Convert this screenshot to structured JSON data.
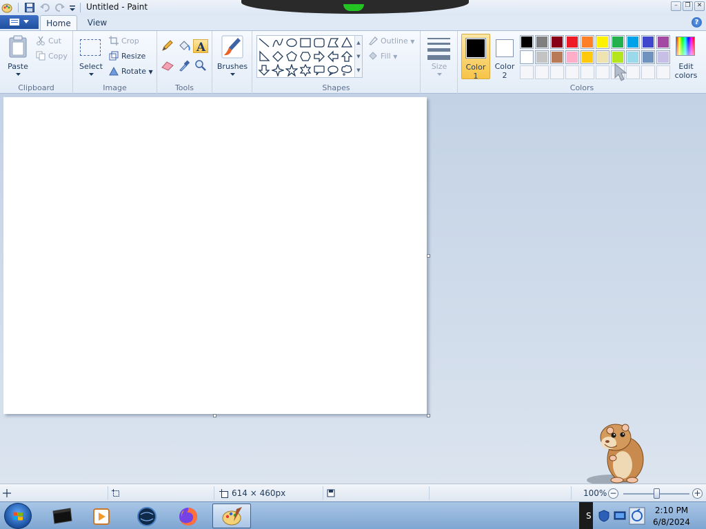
{
  "window": {
    "title": "Untitled - Paint"
  },
  "ribbon": {
    "tabs": [
      {
        "label": "Home"
      },
      {
        "label": "View"
      }
    ],
    "clipboard": {
      "paste_label": "Paste",
      "cut_label": "Cut",
      "copy_label": "Copy",
      "group_label": "Clipboard"
    },
    "image": {
      "select_label": "Select",
      "crop_label": "Crop",
      "resize_label": "Resize",
      "rotate_label": "Rotate",
      "group_label": "Image"
    },
    "tools": {
      "group_label": "Tools"
    },
    "brushes": {
      "label": "Brushes"
    },
    "shapes": {
      "outline_label": "Outline",
      "fill_label": "Fill",
      "group_label": "Shapes"
    },
    "size": {
      "label": "Size"
    },
    "colors": {
      "color1_label_a": "Color",
      "color1_label_b": "1",
      "color2_label_a": "Color",
      "color2_label_b": "2",
      "edit_label_a": "Edit",
      "edit_label_b": "colors",
      "group_label": "Colors",
      "color1": "#000000",
      "color2": "#ffffff",
      "palette_row1": [
        "#000000",
        "#7f7f7f",
        "#880015",
        "#ed1c24",
        "#ff7f27",
        "#fff200",
        "#22b14c",
        "#00a2e8",
        "#3f48cc",
        "#a349a4"
      ],
      "palette_row2": [
        "#ffffff",
        "#c3c3c3",
        "#b97a57",
        "#ffaec9",
        "#ffc90e",
        "#efe4b0",
        "#b5e61d",
        "#99d9ea",
        "#7092be",
        "#c8bfe7"
      ]
    }
  },
  "statusbar": {
    "canvas_size": "614 × 460px",
    "zoom": "100%",
    "zoom_level": 0.5
  },
  "taskbar": {
    "time": "2:10 PM",
    "date": "6/8/2024",
    "tray_letter": "S"
  }
}
